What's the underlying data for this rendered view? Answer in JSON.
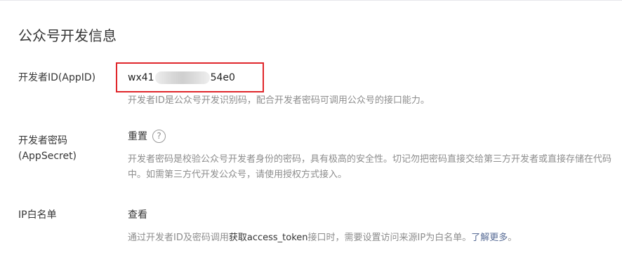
{
  "section": {
    "title": "公众号开发信息"
  },
  "appid": {
    "label": "开发者ID(AppID)",
    "value_prefix": "wx41",
    "value_suffix": "54e0",
    "description": "开发者ID是公众号开发识别码，配合开发者密码可调用公众号的接口能力。"
  },
  "appsecret": {
    "label": "开发者密码(AppSecret)",
    "reset_label": "重置",
    "help_icon": "question-circle-icon",
    "help_glyph": "?",
    "description": "开发者密码是校验公众号开发者身份的密码，具有极高的安全性。切记勿把密码直接交给第三方开发者或直接存储在代码中。如需第三方代开发公众号，请使用授权方式接入。"
  },
  "ip_whitelist": {
    "label": "IP白名单",
    "view_label": "查看",
    "description_before": "通过开发者ID及密码调用",
    "link_label": "获取access_token",
    "description_after": "接口时，需要设置访问来源IP为白名单。",
    "learn_more_label": "了解更多",
    "learn_more_suffix": "。"
  },
  "colors": {
    "highlight_box": "#e0262b",
    "link": "#576b95",
    "muted_text": "#8d8d8d"
  }
}
